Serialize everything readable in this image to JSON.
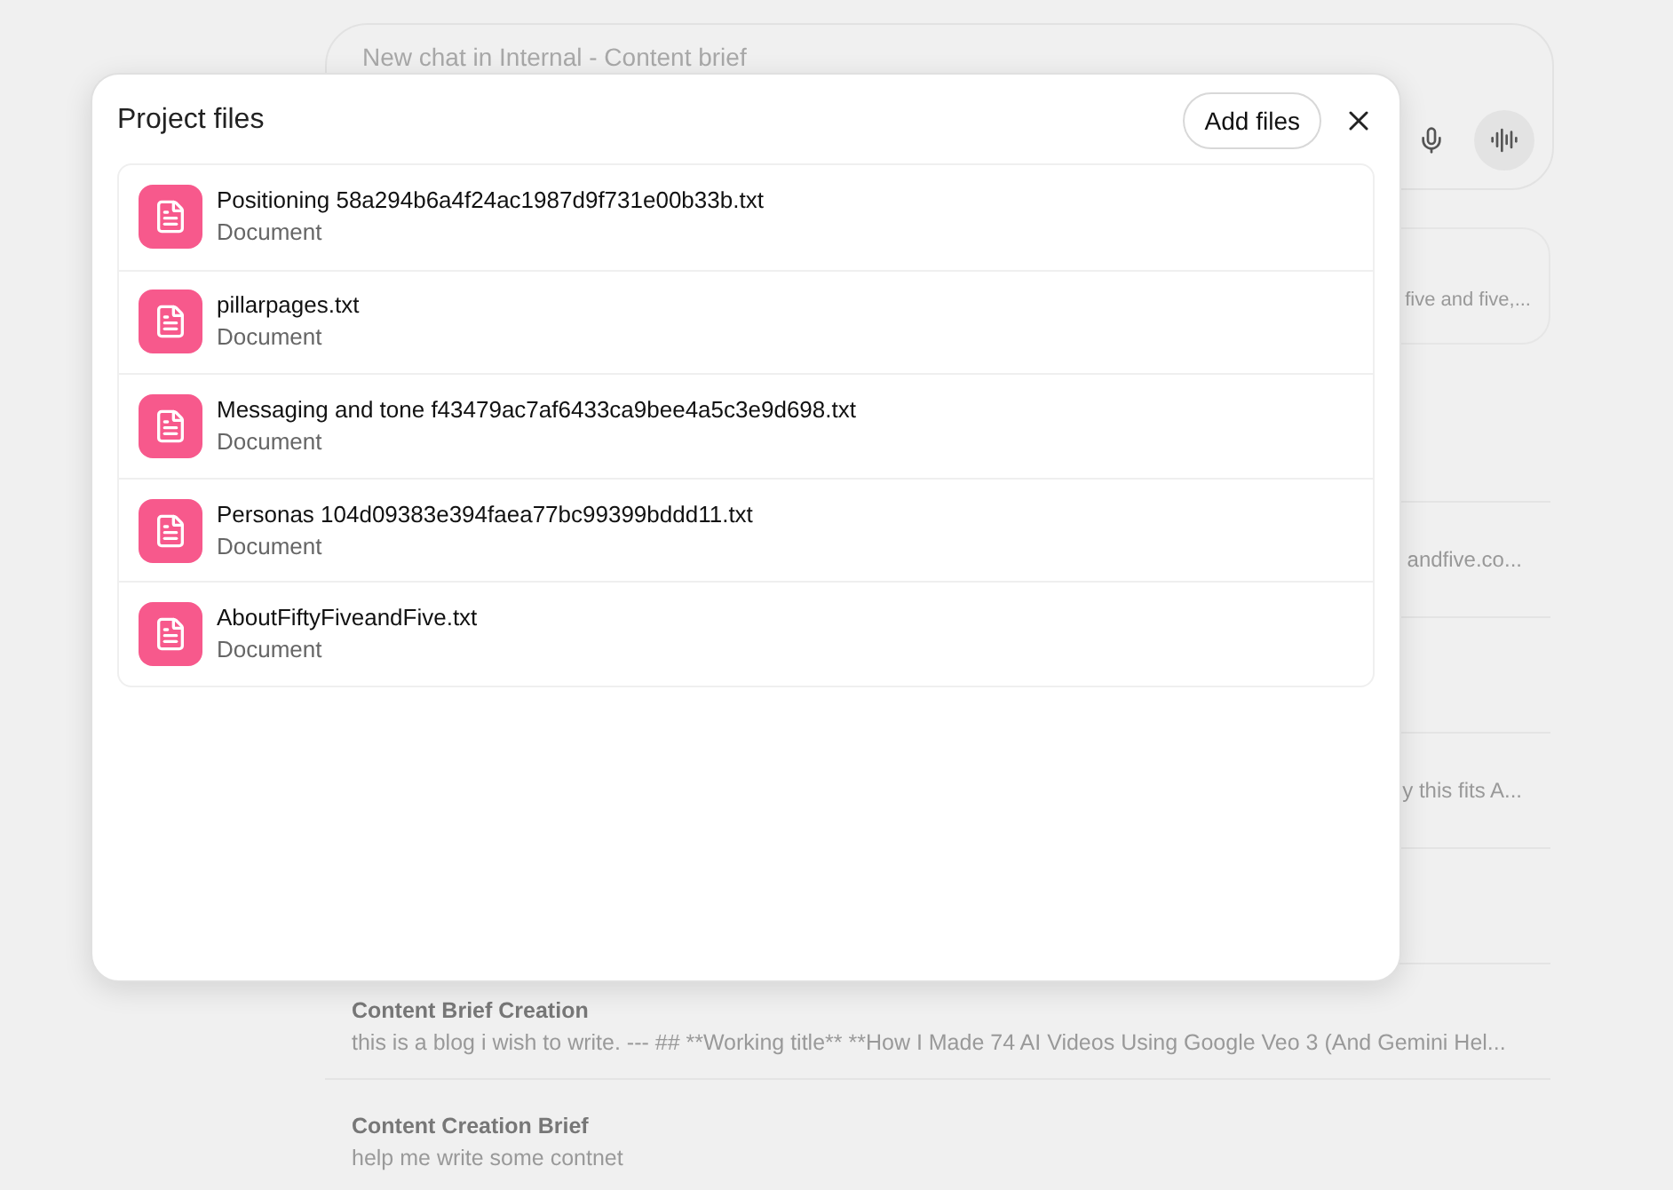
{
  "composer": {
    "placeholder": "New chat in Internal - Content brief"
  },
  "project_card": {
    "snippet": "five and five,..."
  },
  "chats": [
    {
      "kind": "fragment",
      "snippet": "andfive.co..."
    },
    {
      "kind": "fragment",
      "snippet": "y this fits A..."
    },
    {
      "kind": "full",
      "title": "Content Brief Creation",
      "snippet": "this is a blog i wish to write. --- ## **Working title** **How I Made 74 AI Videos Using Google Veo 3 (And Gemini Hel..."
    },
    {
      "kind": "full",
      "title": "Content Creation Brief",
      "snippet": "help me write some contnet"
    }
  ],
  "dialog": {
    "title": "Project files",
    "add_button": "Add files",
    "files": [
      {
        "name": "Positioning 58a294b6a4f24ac1987d9f731e00b33b.txt",
        "type": "Document"
      },
      {
        "name": "pillarpages.txt",
        "type": "Document"
      },
      {
        "name": "Messaging and tone f43479ac7af6433ca9bee4a5c3e9d698.txt",
        "type": "Document"
      },
      {
        "name": "Personas 104d09383e394faea77bc99399bddd11.txt",
        "type": "Document"
      },
      {
        "name": "AboutFiftyFiveandFive.txt",
        "type": "Document"
      }
    ]
  }
}
